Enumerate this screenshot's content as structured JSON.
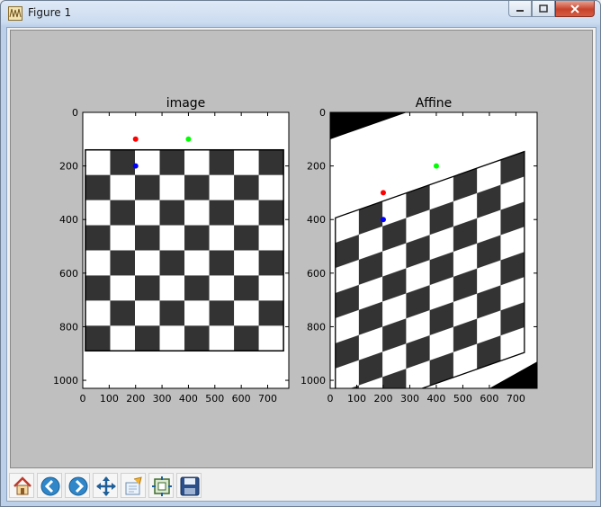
{
  "window": {
    "title": "Figure 1",
    "icon": "matplotlib-figure-icon",
    "controls": [
      "minimize-icon",
      "maximize-icon",
      "close-icon"
    ]
  },
  "toolbar": {
    "buttons": [
      {
        "name": "home-button",
        "icon": "home-icon",
        "tooltip": ""
      },
      {
        "name": "back-button",
        "icon": "back-arrow-icon",
        "tooltip": ""
      },
      {
        "name": "forward-button",
        "icon": "forward-arrow-icon",
        "tooltip": ""
      },
      {
        "name": "pan-button",
        "icon": "pan-move-icon",
        "tooltip": ""
      },
      {
        "name": "zoom-button",
        "icon": "zoom-rect-icon",
        "tooltip": ""
      },
      {
        "name": "configure-subplots-button",
        "icon": "subplots-icon",
        "tooltip": ""
      },
      {
        "name": "save-button",
        "icon": "save-disk-icon",
        "tooltip": ""
      }
    ]
  },
  "colors": {
    "figure_bg": "#bfbfbf",
    "checker_dark": "#333333",
    "checker_light": "#ffffff",
    "point_red": "#ff0000",
    "point_green": "#00ff00",
    "point_blue": "#0000ff"
  },
  "chart_data": [
    {
      "type": "image",
      "title": "image",
      "xticks": [
        "0",
        "100",
        "200",
        "300",
        "400",
        "500",
        "600",
        "700"
      ],
      "yticks": [
        "0",
        "200",
        "400",
        "600",
        "800",
        "1000"
      ],
      "xlim": [
        0,
        780
      ],
      "ylim": [
        1030,
        0
      ],
      "board": {
        "x0": 10,
        "x1": 760,
        "y0": 140,
        "y1": 890,
        "rows": 8,
        "cols": 8,
        "top_left_color": "light"
      },
      "points": [
        {
          "x": 200,
          "y": 100,
          "color": "red"
        },
        {
          "x": 400,
          "y": 100,
          "color": "green"
        },
        {
          "x": 200,
          "y": 200,
          "color": "blue"
        }
      ]
    },
    {
      "type": "image",
      "title": "Affine",
      "xticks": [
        "0",
        "100",
        "200",
        "300",
        "400",
        "500",
        "600",
        "700"
      ],
      "yticks": [
        "0",
        "200",
        "400",
        "600",
        "800",
        "1000"
      ],
      "xlim": [
        0,
        780
      ],
      "ylim": [
        1030,
        0
      ],
      "affine": {
        "ax": 0.95,
        "bx": 0.0,
        "cx": 10,
        "ay": -0.33,
        "by": 1.0,
        "cy": 397
      },
      "points": [
        {
          "x": 400,
          "y": 200,
          "color": "green"
        },
        {
          "x": 200,
          "y": 300,
          "color": "red"
        },
        {
          "x": 200,
          "y": 400,
          "color": "blue"
        }
      ]
    }
  ]
}
